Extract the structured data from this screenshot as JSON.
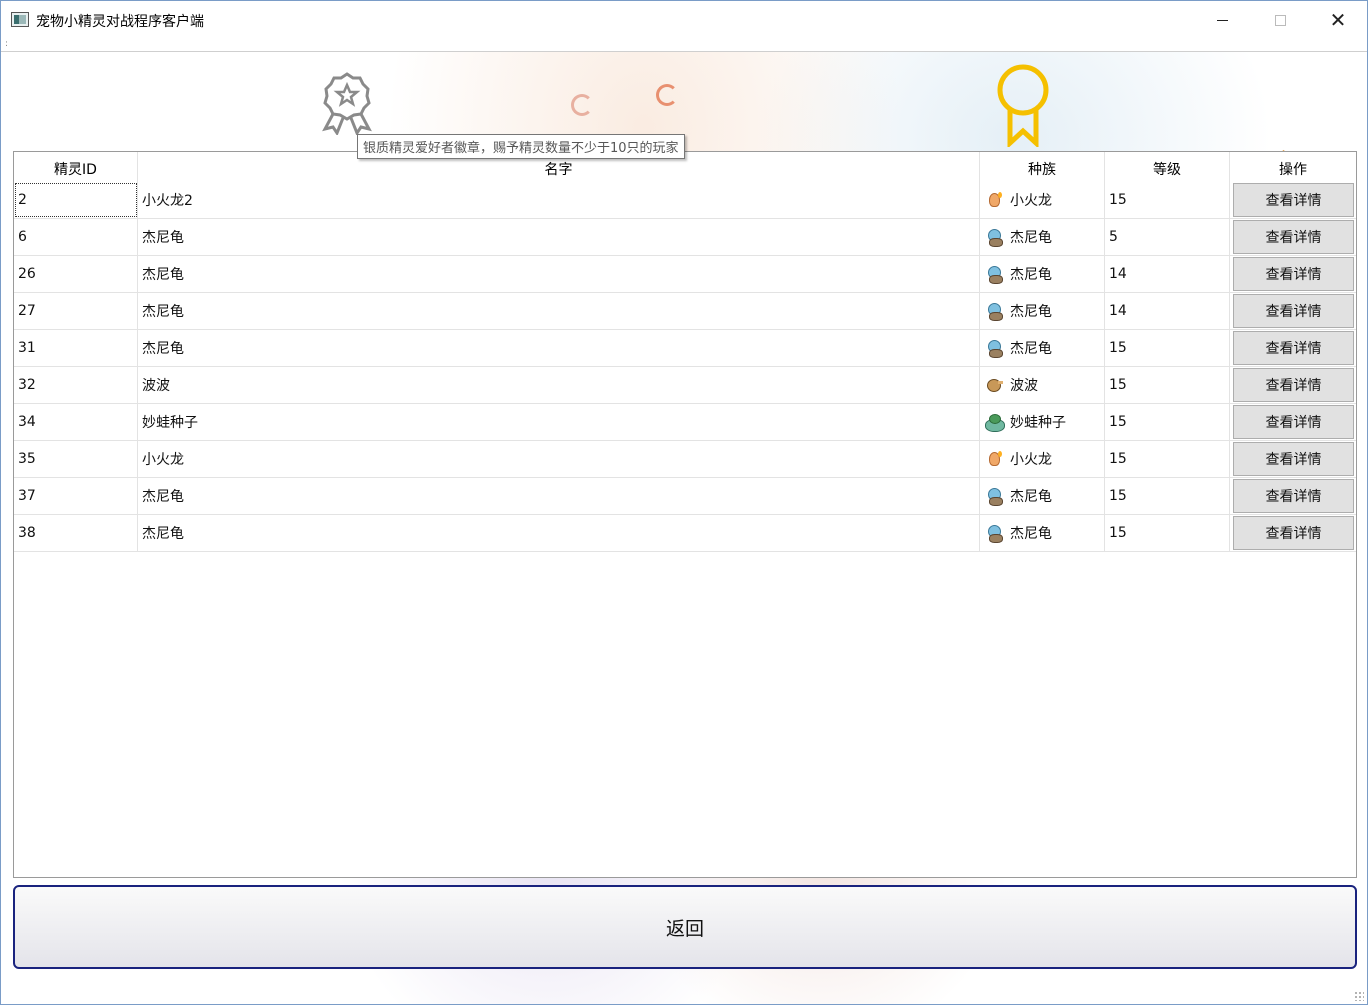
{
  "window": {
    "title": "宠物小精灵对战程序客户端",
    "minimize_icon": "minimize-icon",
    "maximize_icon": "maximize-icon",
    "close_icon": "close-icon",
    "menu_marker": ":"
  },
  "badges": {
    "silver_icon": "silver-badge-icon",
    "gold_icon": "gold-badge-icon",
    "silver_color": "#8a8a8a",
    "gold_color": "#f5c000",
    "tooltip": "银质精灵爱好者徽章，赐予精灵数量不少于10只的玩家"
  },
  "table": {
    "columns": {
      "id": "精灵ID",
      "name": "名字",
      "race": "种族",
      "level": "等级",
      "op": "操作"
    },
    "detail_label": "查看详情",
    "rows": [
      {
        "id": "2",
        "name": "小火龙2",
        "race": "小火龙",
        "race_icon": "charmander-icon",
        "level": "15"
      },
      {
        "id": "6",
        "name": "杰尼龟",
        "race": "杰尼龟",
        "race_icon": "squirtle-icon",
        "level": "5"
      },
      {
        "id": "26",
        "name": "杰尼龟",
        "race": "杰尼龟",
        "race_icon": "squirtle-icon",
        "level": "14"
      },
      {
        "id": "27",
        "name": "杰尼龟",
        "race": "杰尼龟",
        "race_icon": "squirtle-icon",
        "level": "14"
      },
      {
        "id": "31",
        "name": "杰尼龟",
        "race": "杰尼龟",
        "race_icon": "squirtle-icon",
        "level": "15"
      },
      {
        "id": "32",
        "name": "波波",
        "race": "波波",
        "race_icon": "pidgey-icon",
        "level": "15"
      },
      {
        "id": "34",
        "name": "妙蛙种子",
        "race": "妙蛙种子",
        "race_icon": "bulbasaur-icon",
        "level": "15"
      },
      {
        "id": "35",
        "name": "小火龙",
        "race": "小火龙",
        "race_icon": "charmander-icon",
        "level": "15"
      },
      {
        "id": "37",
        "name": "杰尼龟",
        "race": "杰尼龟",
        "race_icon": "squirtle-icon",
        "level": "15"
      },
      {
        "id": "38",
        "name": "杰尼龟",
        "race": "杰尼龟",
        "race_icon": "squirtle-icon",
        "level": "15"
      }
    ]
  },
  "footer": {
    "return_label": "返回",
    "return_border_color": "#1a237e"
  }
}
